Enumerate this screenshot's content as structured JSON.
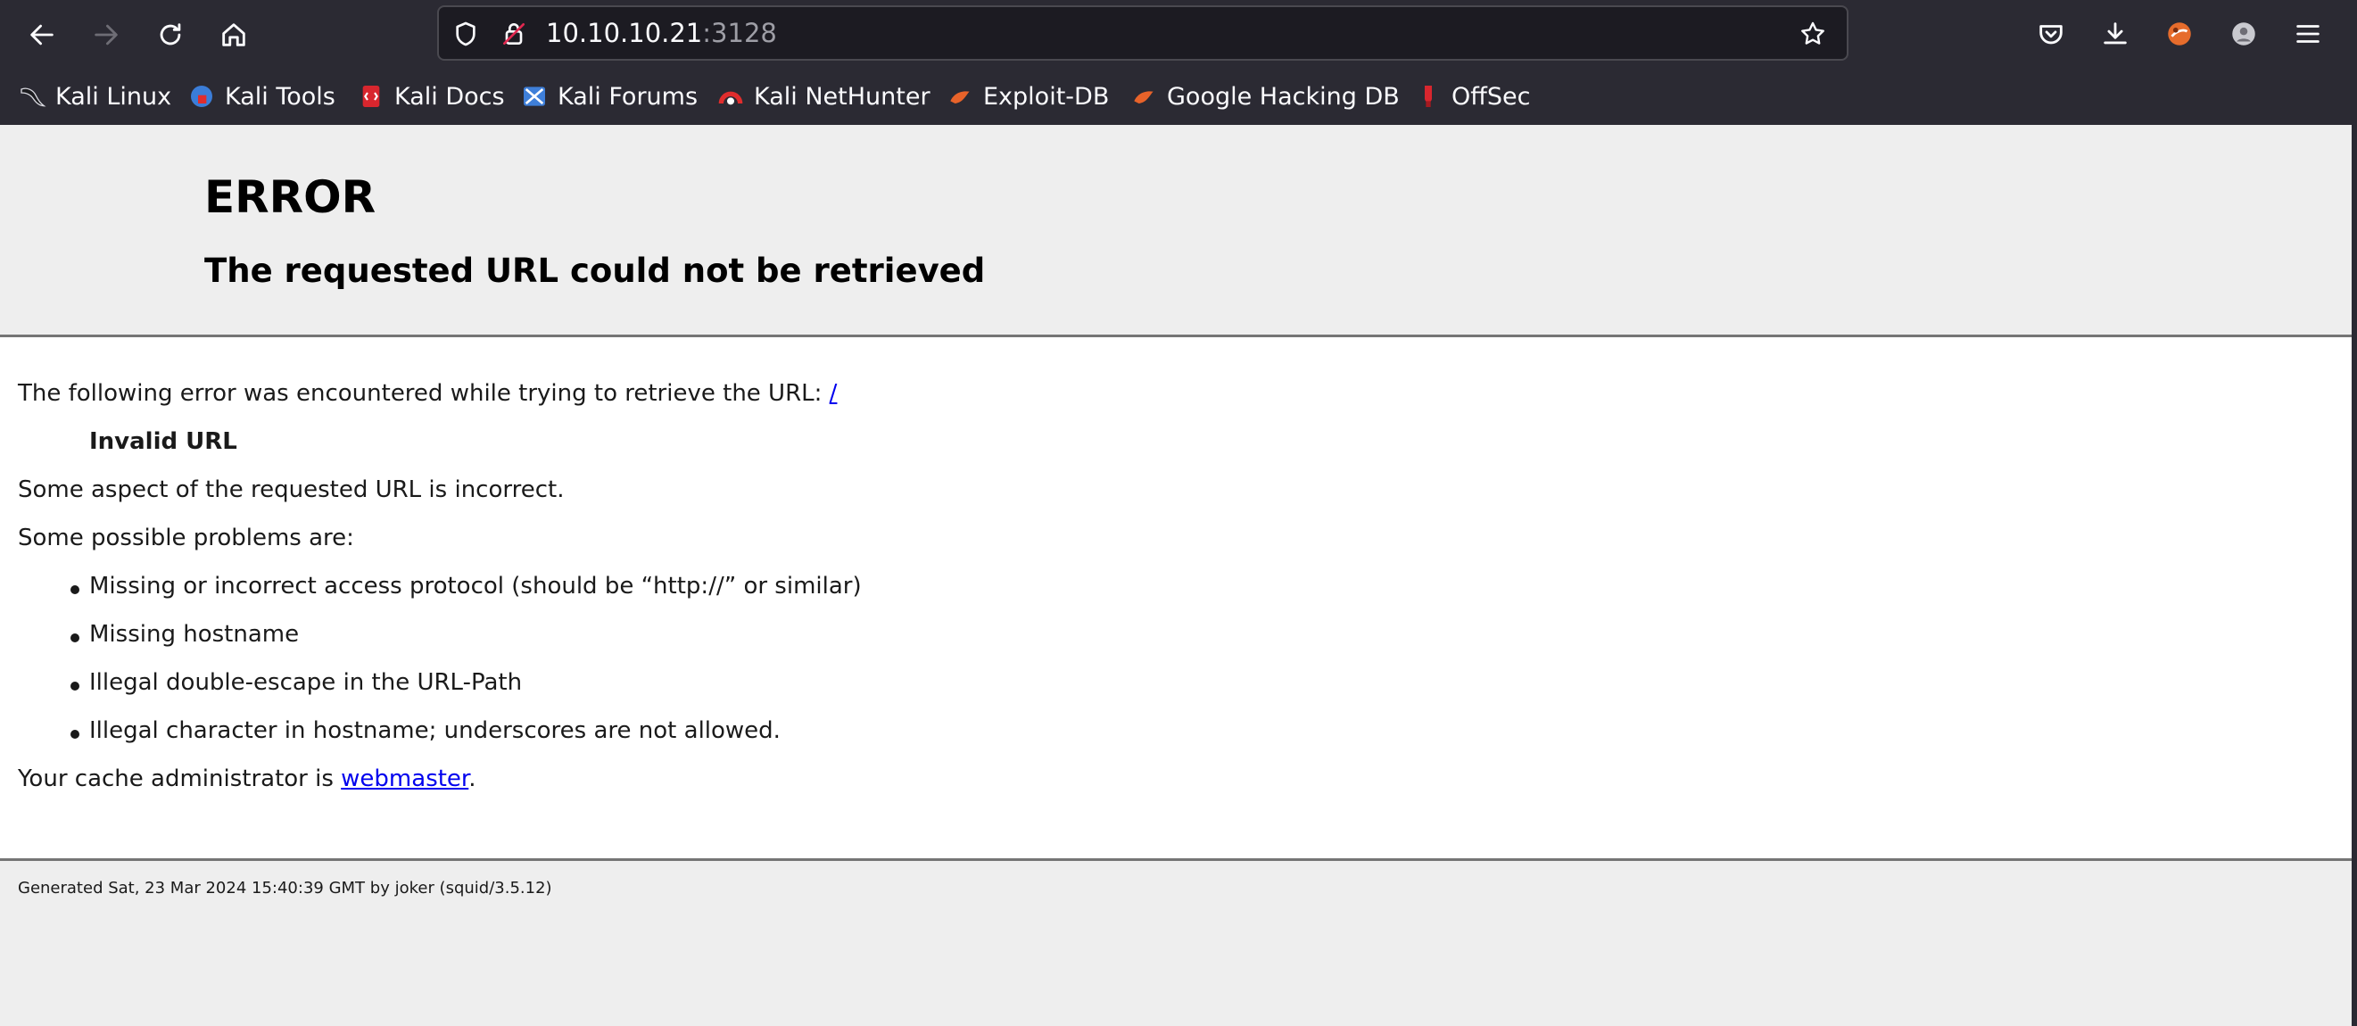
{
  "browser": {
    "url_host": "10.10.10.21",
    "url_port": ":3128",
    "icons": {
      "back": "back-arrow-icon",
      "forward": "forward-arrow-icon",
      "reload": "reload-icon",
      "home": "home-icon",
      "tracking": "shield-icon",
      "security": "lock-icon",
      "bookmark": "star-icon",
      "pocket": "pocket-icon",
      "downloads": "download-icon",
      "extension": "extension-icon",
      "account": "account-icon",
      "menu": "hamburger-menu-icon"
    },
    "bookmarks": [
      {
        "label": "Kali Linux",
        "icon": "kali-dragon-icon"
      },
      {
        "label": "Kali Tools",
        "icon": "kali-tools-icon"
      },
      {
        "label": "Kali Docs",
        "icon": "kali-docs-icon"
      },
      {
        "label": "Kali Forums",
        "icon": "kali-forums-icon"
      },
      {
        "label": "Kali NetHunter",
        "icon": "nethunter-icon"
      },
      {
        "label": "Exploit-DB",
        "icon": "exploit-db-icon"
      },
      {
        "label": "Google Hacking DB",
        "icon": "ghdb-icon"
      },
      {
        "label": "OffSec",
        "icon": "offsec-icon"
      }
    ],
    "colors": {
      "chrome_bg": "#2b2a33",
      "urlbar_bg": "#1c1b22",
      "text": "#fbfbfe"
    }
  },
  "page": {
    "title": "ERROR",
    "subtitle": "The requested URL could not be retrieved",
    "intro": "The following error was encountered while trying to retrieve the URL: ",
    "intro_link": "/",
    "error_name": "Invalid URL",
    "desc": "Some aspect of the requested URL is incorrect.",
    "problems_heading": "Some possible problems are:",
    "problems": [
      "Missing or incorrect access protocol (should be “http://” or similar)",
      "Missing hostname",
      "Illegal double-escape in the URL-Path",
      "Illegal character in hostname; underscores are not allowed."
    ],
    "admin_prefix": "Your cache administrator is ",
    "admin_link": "webmaster",
    "admin_suffix": ".",
    "footer": "Generated Sat, 23 Mar 2024 15:40:39 GMT by joker (squid/3.5.12)",
    "colors": {
      "link": "#0000ee",
      "band_bg": "#eeeeee",
      "rule": "#757575"
    }
  }
}
